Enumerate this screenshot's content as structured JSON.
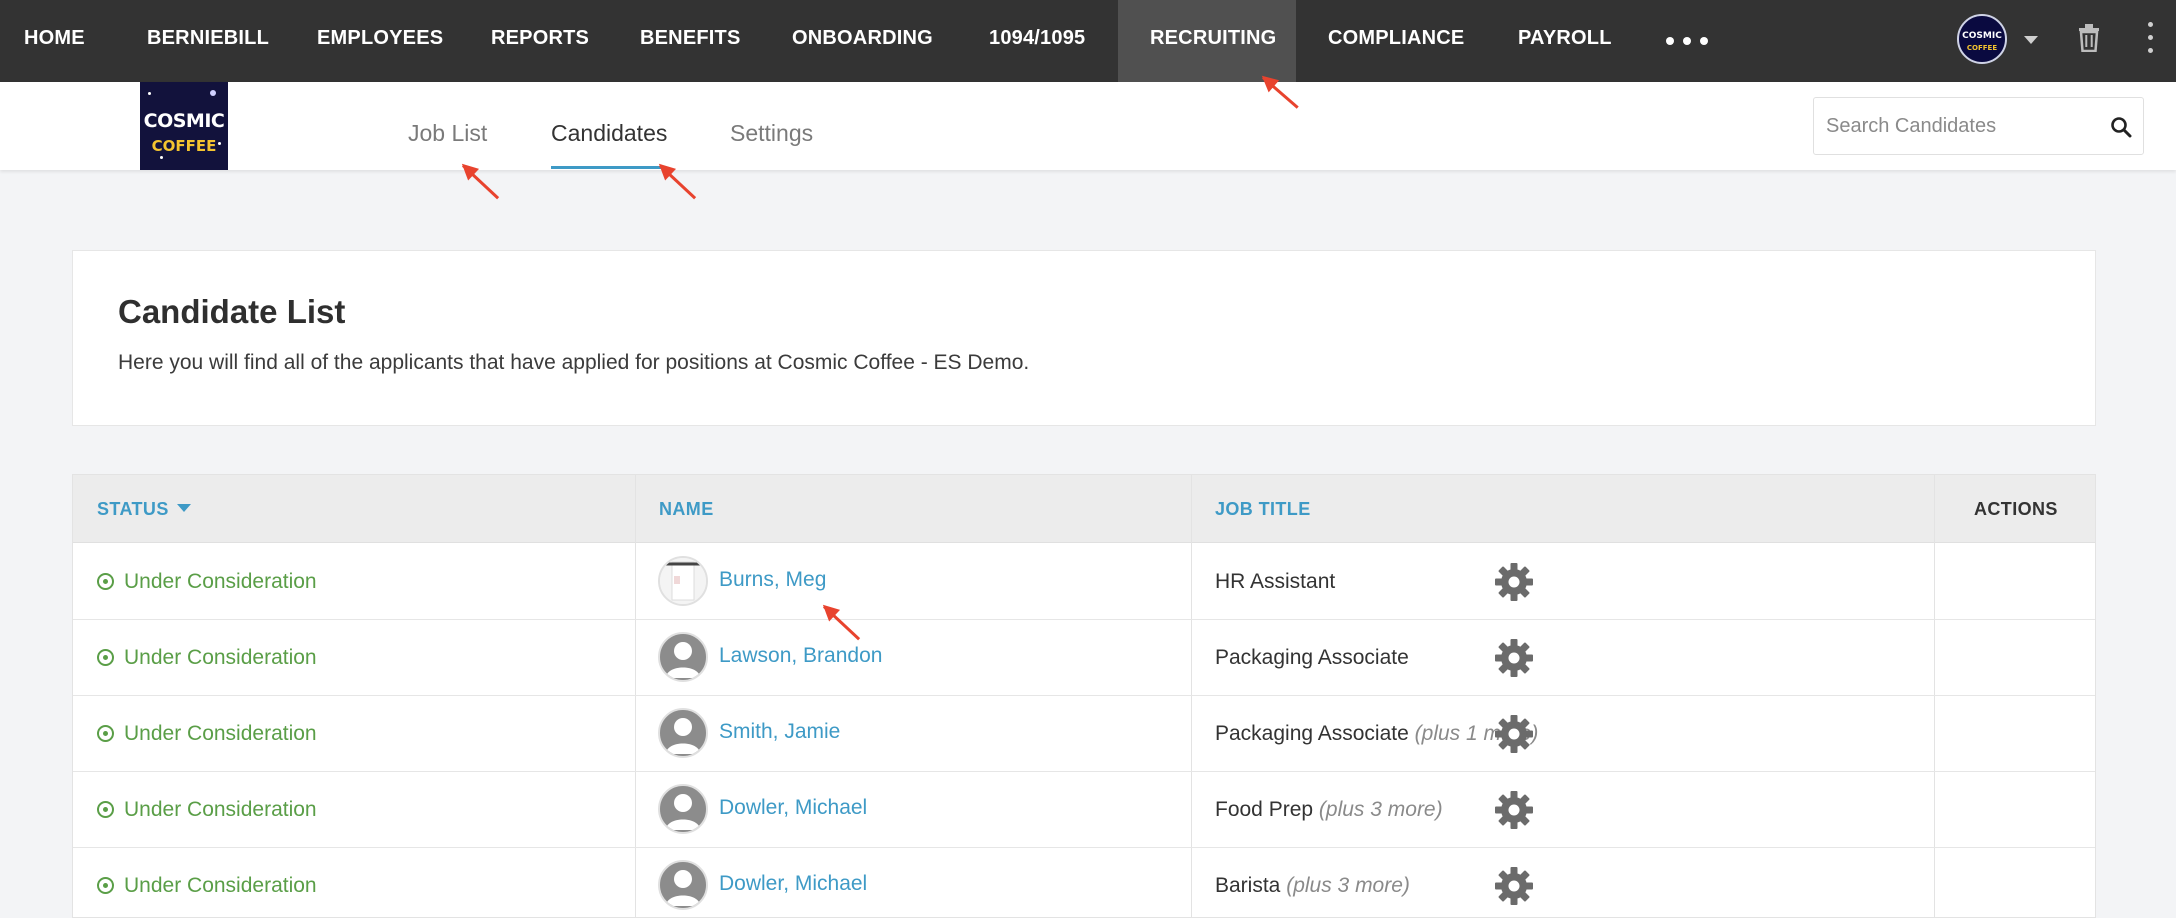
{
  "topnav": {
    "items": [
      {
        "label": "HOME"
      },
      {
        "label": "BERNIEBILL"
      },
      {
        "label": "EMPLOYEES"
      },
      {
        "label": "REPORTS"
      },
      {
        "label": "BENEFITS"
      },
      {
        "label": "ONBOARDING"
      },
      {
        "label": "1094/1095"
      },
      {
        "label": "RECRUITING"
      },
      {
        "label": "COMPLIANCE"
      },
      {
        "label": "PAYROLL"
      }
    ],
    "active": "RECRUITING",
    "more_icon": "ellipsis-icon",
    "avatar_text_1": "COSMIC",
    "avatar_text_2": "COFFEE"
  },
  "subheader": {
    "logo_line1": "COSMIC",
    "logo_line2": "COFFEE",
    "tabs": [
      {
        "label": "Job List"
      },
      {
        "label": "Candidates"
      },
      {
        "label": "Settings"
      }
    ],
    "active_tab": "Candidates",
    "search": {
      "placeholder": "Search Candidates",
      "value": ""
    }
  },
  "intro": {
    "title": "Candidate List",
    "description": "Here you will find all of the applicants that have applied for positions at Cosmic Coffee - ES Demo."
  },
  "table": {
    "headers": {
      "status": "STATUS",
      "name": "NAME",
      "job_title": "JOB TITLE",
      "actions": "ACTIONS"
    },
    "rows": [
      {
        "status": "Under Consideration",
        "name": "Burns, Meg",
        "job": "HR Assistant",
        "more": ""
      },
      {
        "status": "Under Consideration",
        "name": "Lawson, Brandon",
        "job": "Packaging Associate",
        "more": ""
      },
      {
        "status": "Under Consideration",
        "name": "Smith, Jamie",
        "job": "Packaging Associate",
        "more": "(plus 1 more)"
      },
      {
        "status": "Under Consideration",
        "name": "Dowler, Michael",
        "job": "Food Prep",
        "more": "(plus 3 more)"
      },
      {
        "status": "Under Consideration",
        "name": "Dowler, Michael",
        "job": "Barista",
        "more": "(plus 3 more)"
      }
    ]
  },
  "colors": {
    "nav_bg": "#333333",
    "accent": "#3e9ac6",
    "status_green": "#5a9e47",
    "annotation_arrow": "#e8432e"
  }
}
